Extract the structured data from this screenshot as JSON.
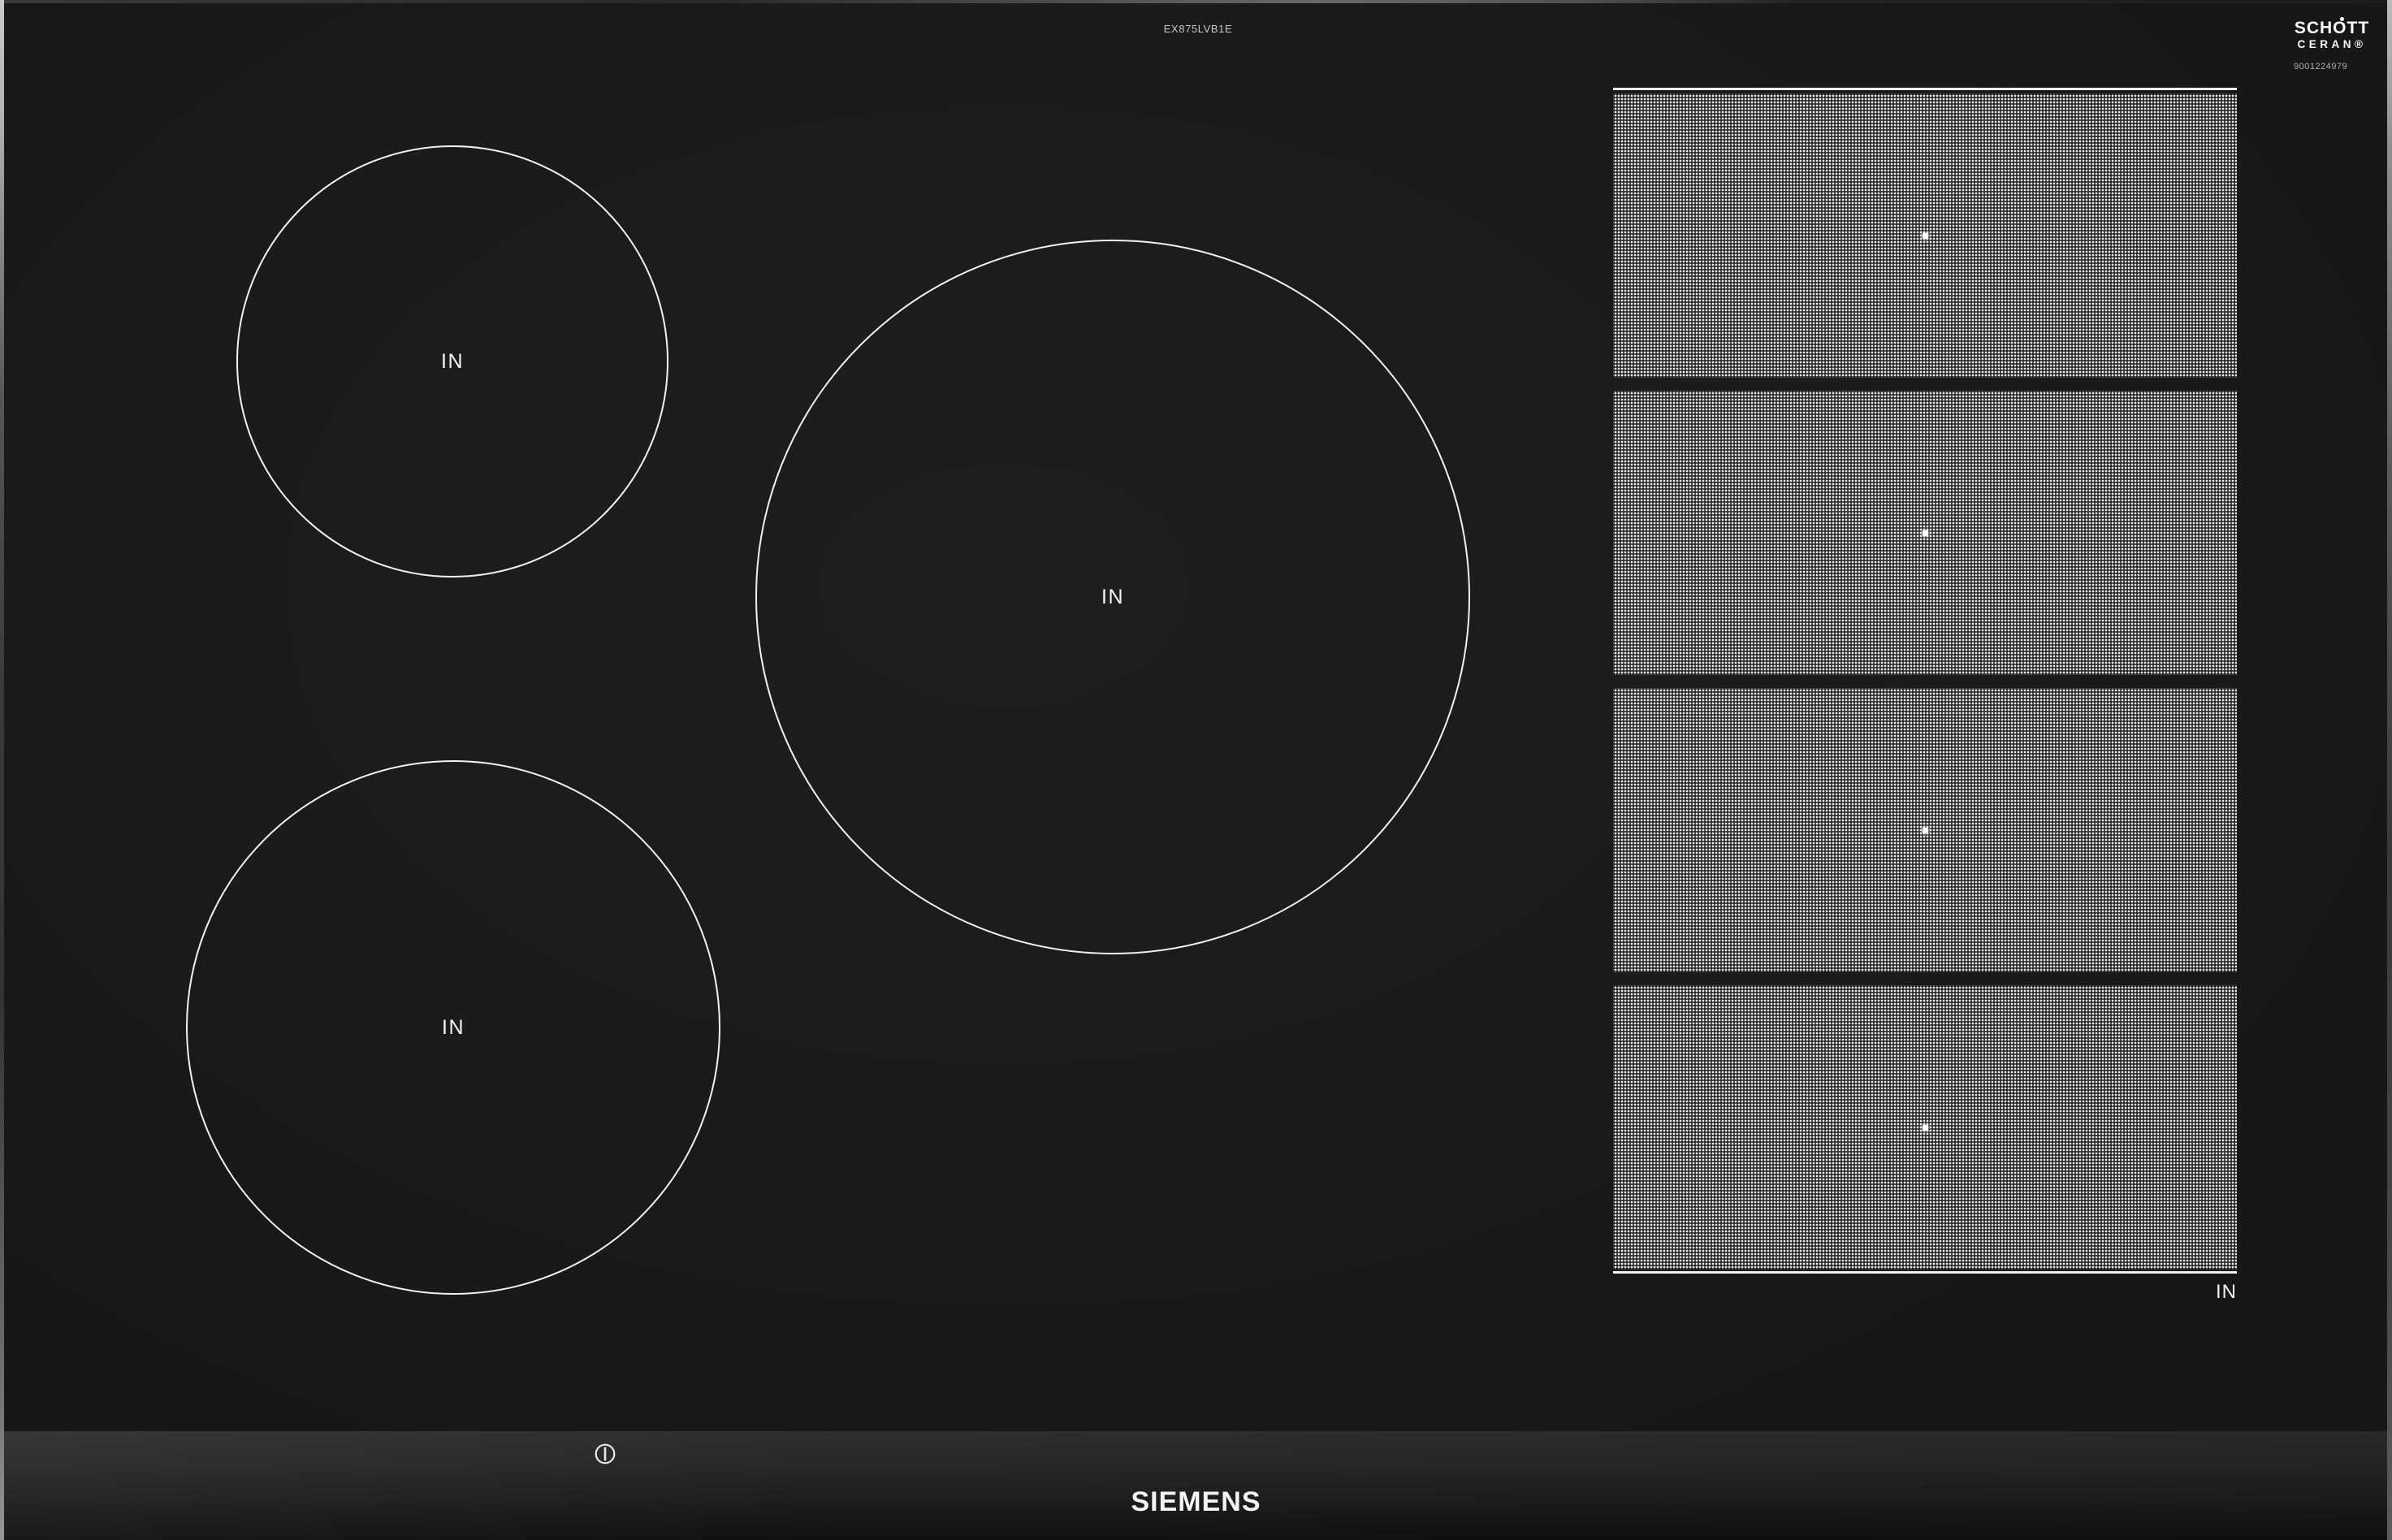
{
  "product": {
    "model": "EX875LVB1E",
    "brand": "SIEMENS"
  },
  "glass_logo": {
    "line1": "SCHOTT",
    "line2": "CERAN®",
    "code": "9001224979"
  },
  "zones": {
    "circle_front_left": {
      "label": "IN"
    },
    "circle_back_left": {
      "label": "IN"
    },
    "circle_center": {
      "label": "IN"
    },
    "flex_right": {
      "label": "IN",
      "segment_count": 4
    }
  },
  "controls": {
    "power_icon": "power-symbol"
  },
  "colors": {
    "surface": "#1d1b1a",
    "zone_outline": "#f2f1ef",
    "text": "#f5f4f2",
    "front_strip_top": "#302f2d",
    "front_strip_bottom": "#121110",
    "edge_highlight": "#b2b6b9"
  }
}
